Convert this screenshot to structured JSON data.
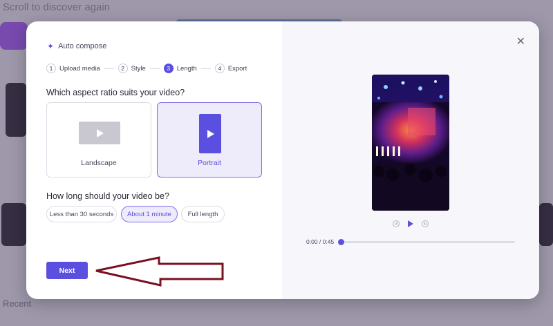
{
  "background": {
    "title": "Scroll to discover again",
    "sections": [
      "Recent"
    ]
  },
  "header": {
    "title": "Auto compose",
    "sparkle_icon": "sparkle-icon"
  },
  "steps": [
    {
      "number": "1",
      "label": "Upload media"
    },
    {
      "number": "2",
      "label": "Style"
    },
    {
      "number": "3",
      "label": "Length"
    },
    {
      "number": "4",
      "label": "Export"
    }
  ],
  "aspect": {
    "question": "Which aspect ratio suits your video?",
    "options": [
      {
        "label": "Landscape",
        "selected": false
      },
      {
        "label": "Portrait",
        "selected": true
      }
    ]
  },
  "length": {
    "question": "How long should your video be?",
    "options": [
      {
        "label": "Less than 30 seconds",
        "selected": false
      },
      {
        "label": "About 1 minute",
        "selected": true
      },
      {
        "label": "Full length",
        "selected": false
      }
    ]
  },
  "actions": {
    "next_label": "Next"
  },
  "player": {
    "time": "0:00 / 0:45",
    "progress": 0
  },
  "colors": {
    "accent": "#5b4fe0",
    "arrow": "#7a1020"
  }
}
